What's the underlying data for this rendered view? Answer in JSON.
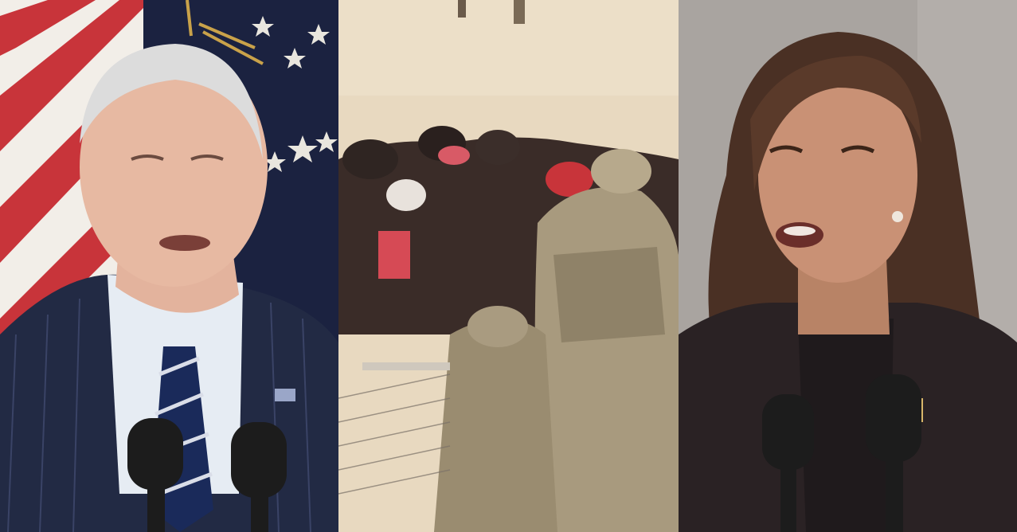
{
  "panels": [
    {
      "id": "left",
      "subject": "man-at-podium"
    },
    {
      "id": "middle",
      "subject": "border-scene"
    },
    {
      "id": "right",
      "subject": "woman-at-podium"
    }
  ],
  "colors": {
    "flag_red": "#c8343a",
    "flag_white": "#f2eee8",
    "navy_backdrop": "#1b2240",
    "suit_navy": "#222a44",
    "sand": "#e8d9c0",
    "camo": "#a89a7e",
    "wall_gray": "#a9a4a0",
    "suit_dark": "#2a2224",
    "mic_black": "#1c1c1c"
  }
}
